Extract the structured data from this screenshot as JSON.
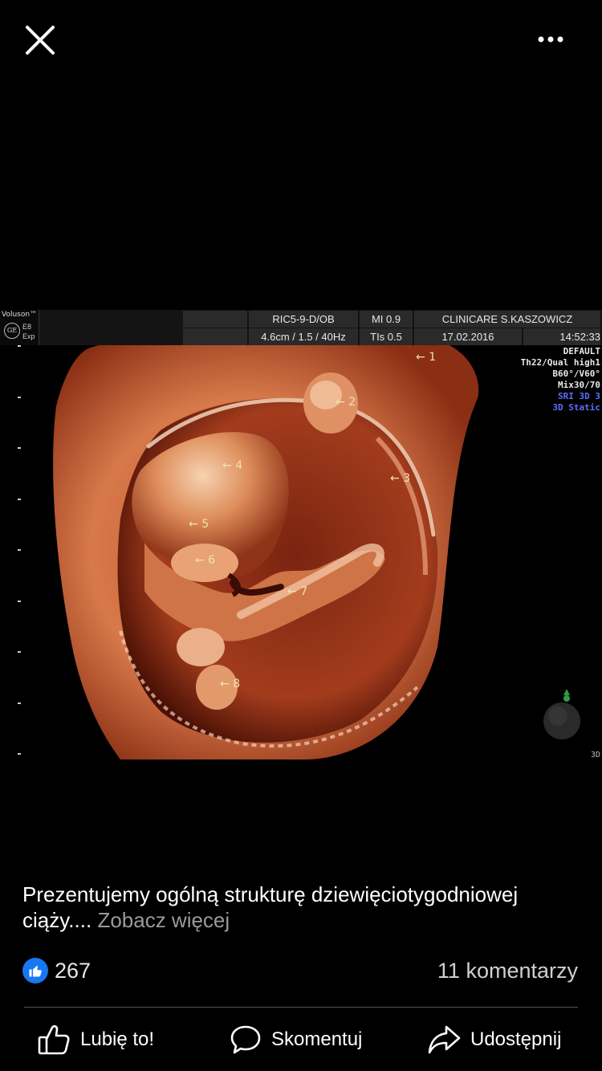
{
  "topbar": {
    "close_icon": "close-icon",
    "more_icon": "more-horizontal-icon"
  },
  "ultrasound": {
    "brand": "Voluson™",
    "logo": "GE",
    "model_line1": "E8",
    "model_line2": "Exp",
    "probe": "RIC5-9-D/OB",
    "mi": "MI  0.9",
    "clinic": "CLINICARE S.KASZOWICZ",
    "depth": "4.6cm / 1.5 / 40Hz",
    "tis": "TIs  0.5",
    "date": "17.02.2016",
    "time": "14:52:33",
    "settings": [
      "DEFAULT",
      "Th22/Qual high1",
      "B60°/V60°",
      "Mix30/70"
    ],
    "settings_blue": [
      "SRI 3D 3",
      "3D Static"
    ],
    "mode_badge": "3D",
    "labels": [
      {
        "arrow": "←",
        "num": "1"
      },
      {
        "arrow": "←",
        "num": "2"
      },
      {
        "arrow": "←",
        "num": "3"
      },
      {
        "arrow": "←",
        "num": "4"
      },
      {
        "arrow": "←",
        "num": "5"
      },
      {
        "arrow": "←",
        "num": "6"
      },
      {
        "arrow": "←",
        "num": "7"
      },
      {
        "arrow": "←",
        "num": "8"
      }
    ],
    "colors": {
      "tissue": "#d8794a",
      "tissue_light": "#f4c7a0",
      "shadow": "#3a0c05"
    }
  },
  "post": {
    "caption": "Prezentujemy ogólną strukturę dziewięciotygodniowej ciąży....",
    "see_more": "Zobacz więcej",
    "like_count": "267",
    "comment_count": "11 komentarzy"
  },
  "actions": {
    "like": "Lubię to!",
    "comment": "Skomentuj",
    "share": "Udostępnij"
  },
  "colors": {
    "like_blue": "#1877f2"
  }
}
